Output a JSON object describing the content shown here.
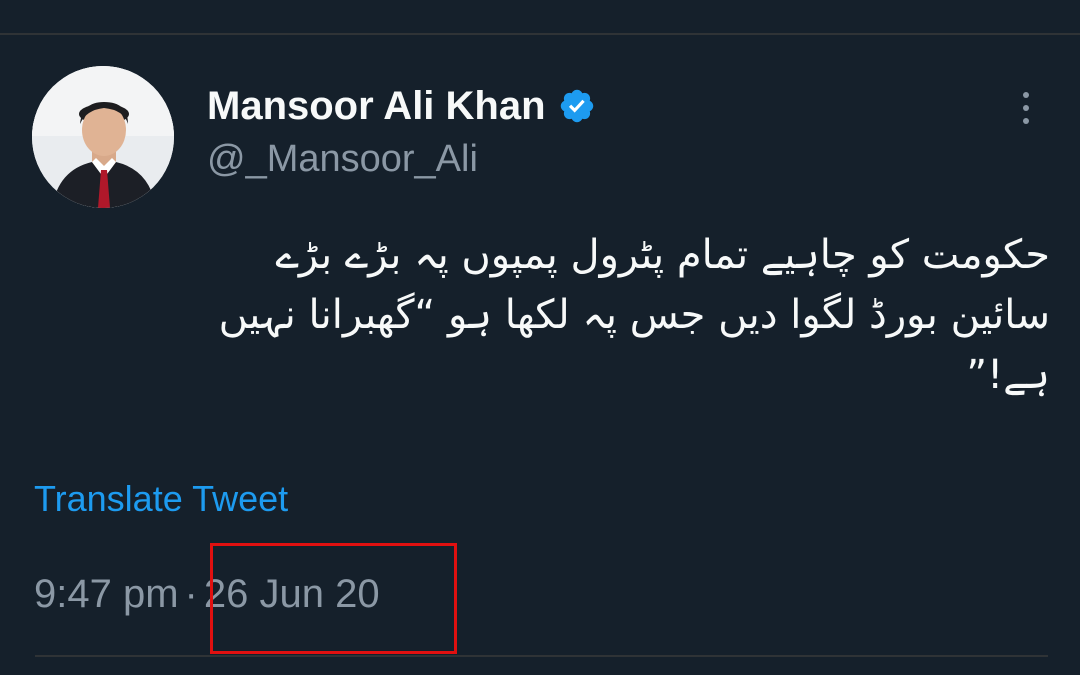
{
  "author": {
    "display_name": "Mansoor Ali Khan",
    "handle": "@_Mansoor_Ali",
    "verified": true
  },
  "tweet": {
    "text": "حکومت کو چاہیے تمام پٹرول پمپوں پہ بڑے بڑے\nسائین بورڈ لگوا دیں جس پہ لکھا ہو “گھبرانا نہیں\nہے!”",
    "translate_label": "Translate Tweet",
    "time": "9:47 pm",
    "separator": "·",
    "date": "26 Jun 20"
  },
  "icons": {
    "verified": "verified-badge-icon",
    "more": "more-vertical-icon",
    "avatar": "profile-photo"
  },
  "colors": {
    "background": "#15202b",
    "text": "#f7f9f9",
    "secondary": "#8b98a5",
    "link": "#1d9bf0",
    "verified": "#1d9bf0",
    "highlight": "#e01010"
  }
}
